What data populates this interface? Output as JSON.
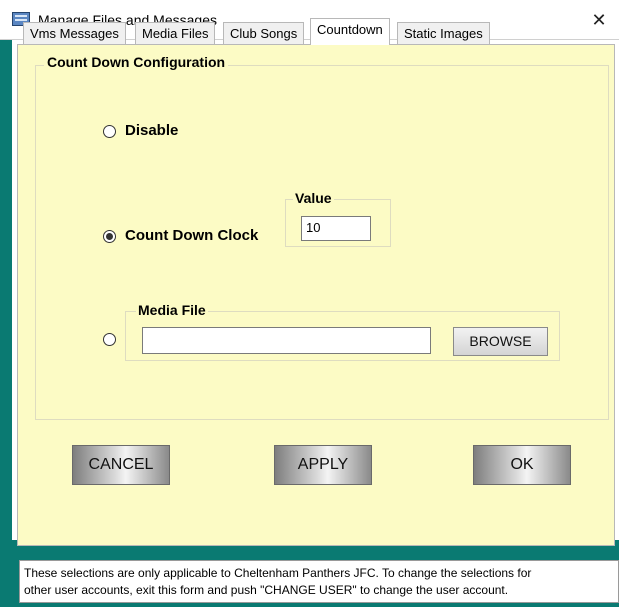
{
  "window": {
    "title": "Manage Files and Messages",
    "close_symbol": "✕"
  },
  "tabs": [
    {
      "label": "Vms Messages",
      "active": false
    },
    {
      "label": "Media Files",
      "active": false
    },
    {
      "label": "Club Songs",
      "active": false
    },
    {
      "label": "Countdown",
      "active": true
    },
    {
      "label": "Static Images",
      "active": false
    }
  ],
  "config": {
    "group_title": "Count Down Configuration",
    "options": {
      "disable_label": "Disable",
      "countdown_label": "Count Down Clock",
      "selected": "countdown"
    },
    "value_group": {
      "label": "Value",
      "value": "10"
    },
    "media_group": {
      "label": "Media File",
      "value": "",
      "browse_label": "BROWSE"
    }
  },
  "buttons": {
    "cancel_label": "CANCEL",
    "apply_label": "APPLY",
    "ok_label": "OK"
  },
  "info": {
    "line1": "These selections are only applicable to Cheltenham Panthers JFC. To change the selections for",
    "line2": "other user accounts, exit this form and push \"CHANGE USER\" to change the user account."
  },
  "colors": {
    "frame": "#0a7a72",
    "panel": "#fcfbc5"
  }
}
